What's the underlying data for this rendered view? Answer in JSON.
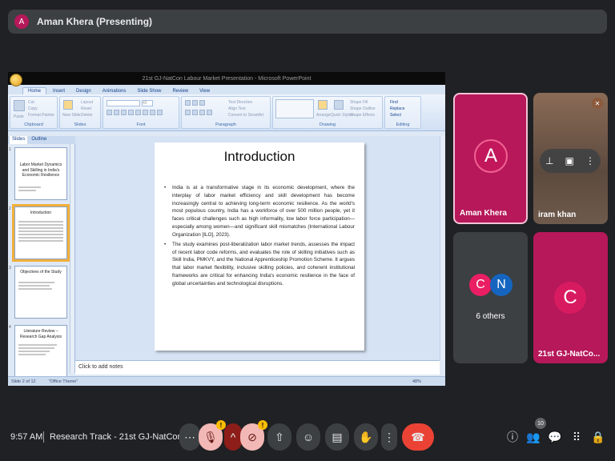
{
  "banner": {
    "avatar_letter": "A",
    "presenter": "Aman Khera (Presenting)"
  },
  "ppt": {
    "window_title": "21st GJ-NatCon Labour Market Presentation - Microsoft PowerPoint",
    "tabs": [
      "Home",
      "Insert",
      "Design",
      "Animations",
      "Slide Show",
      "Review",
      "View"
    ],
    "active_tab": "Home",
    "ribbon": {
      "clipboard": {
        "label": "Clipboard",
        "paste": "Paste",
        "cut": "Cut",
        "copy": "Copy",
        "format_painter": "Format Painter"
      },
      "slides": {
        "label": "Slides",
        "new_slide": "New Slide",
        "layout": "Layout",
        "reset": "Reset",
        "delete": "Delete"
      },
      "font": {
        "label": "Font",
        "size": "40"
      },
      "paragraph": {
        "label": "Paragraph",
        "text_direction": "Text Direction",
        "align_text": "Align Text",
        "convert": "Convert to SmartArt"
      },
      "drawing": {
        "label": "Drawing",
        "arrange": "Arrange",
        "quick_styles": "Quick Styles",
        "shape_fill": "Shape Fill",
        "shape_outline": "Shape Outline",
        "shape_effects": "Shape Effects"
      },
      "editing": {
        "label": "Editing",
        "find": "Find",
        "replace": "Replace",
        "select": "Select"
      }
    },
    "panel_tabs": {
      "slides": "Slides",
      "outline": "Outline"
    },
    "thumbnails": [
      {
        "num": "1",
        "title": "Labor Market Dynamics and Skilling in India's Economic Resilience"
      },
      {
        "num": "2",
        "title": "Introduction"
      },
      {
        "num": "3",
        "title": "Objectives of the Study"
      },
      {
        "num": "4",
        "title": "Literature Review – Research Gap Analysis"
      }
    ],
    "slide": {
      "title": "Introduction",
      "bullets": [
        "India is at a transformative stage in its economic development, where the interplay of labor market efficiency and skill development has become increasingly central to achieving long-term economic resilience. As the world's most populous country, India has a workforce of over 500 million people, yet it faces critical challenges such as high informality, low labor force participation—especially among women—and significant skill mismatches (International Labour Organization [ILO], 2023).",
        "The study examines post-liberalization labor market trends, assesses the impact of recent labor code reforms, and evaluates the role of skilling initiatives such as Skill India, PMKVY, and the National Apprenticeship Promotion Scheme. It argues that labor market flexibility, inclusive skilling policies, and coherent institutional frameworks are critical for enhancing India's economic resilience in the face of global uncertainties and technological disruptions."
      ]
    },
    "notes_placeholder": "Click to add notes",
    "status": {
      "slide_of": "Slide 2 of 12",
      "theme": "\"Office Theme\"",
      "zoom": "48%"
    }
  },
  "participants": {
    "aman": {
      "letter": "A",
      "name": "Aman Khera"
    },
    "iram": {
      "name": "iram khan"
    },
    "others": {
      "letters": [
        "C",
        "N"
      ],
      "label": "6 others"
    },
    "gj": {
      "letter": "C",
      "name": "21st GJ-NatCo..."
    }
  },
  "bottom": {
    "time": "9:57 AM",
    "meeting": "Research Track - 21st GJ-NatCon...",
    "people_count": "10"
  },
  "colors": {
    "tile_magenta": "#b6185a",
    "end_call": "#ea4335",
    "bg": "#202124"
  }
}
